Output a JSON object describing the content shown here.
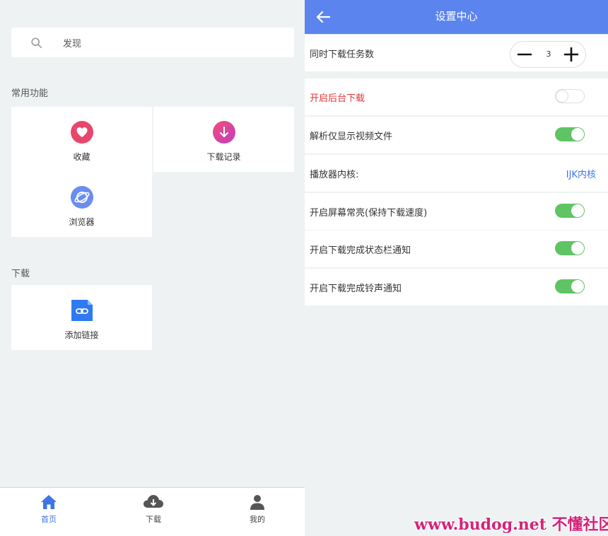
{
  "home": {
    "search": {
      "placeholder": "发现",
      "icon": "search-icon"
    },
    "sections": {
      "common": {
        "title": "常用功能",
        "items": [
          {
            "label": "收藏",
            "icon": "heart-icon",
            "color": "#e8466b"
          },
          {
            "label": "下载记录",
            "icon": "download-arrow-icon",
            "color": "#e0418c"
          },
          {
            "label": "浏览器",
            "icon": "planet-icon",
            "color": "#6b8cf0"
          }
        ]
      },
      "download": {
        "title": "下载",
        "items": [
          {
            "label": "添加链接",
            "icon": "link-file-icon",
            "color": "#2f7af3"
          }
        ]
      }
    },
    "tabbar": [
      {
        "label": "首页",
        "icon": "home-icon",
        "active": true
      },
      {
        "label": "下载",
        "icon": "cloud-download-icon",
        "active": false
      },
      {
        "label": "我的",
        "icon": "user-icon",
        "active": false
      }
    ]
  },
  "settings": {
    "title": "设置中心",
    "back_icon": "arrow-left-icon",
    "concurrent": {
      "label": "同时下载任务数",
      "value": "3"
    },
    "rows": [
      {
        "label": "开启后台下载",
        "type": "toggle",
        "on": false,
        "highlight": true
      },
      {
        "label": "解析仅显示视频文件",
        "type": "toggle",
        "on": true
      },
      {
        "label": "播放器内核:",
        "type": "value",
        "value": "IJK内核"
      },
      {
        "label": "开启屏幕常亮(保持下载速度)",
        "type": "toggle",
        "on": true
      },
      {
        "label": "开启下载完成状态栏通知",
        "type": "toggle",
        "on": true
      },
      {
        "label": "开启下载完成铃声通知",
        "type": "toggle",
        "on": true
      }
    ]
  },
  "watermark": "www.budog.net 不懂社区",
  "colors": {
    "accent": "#5b84ef",
    "toggle_on": "#5fc464",
    "warning_text": "#e03434",
    "link_text": "#3d74e6"
  }
}
